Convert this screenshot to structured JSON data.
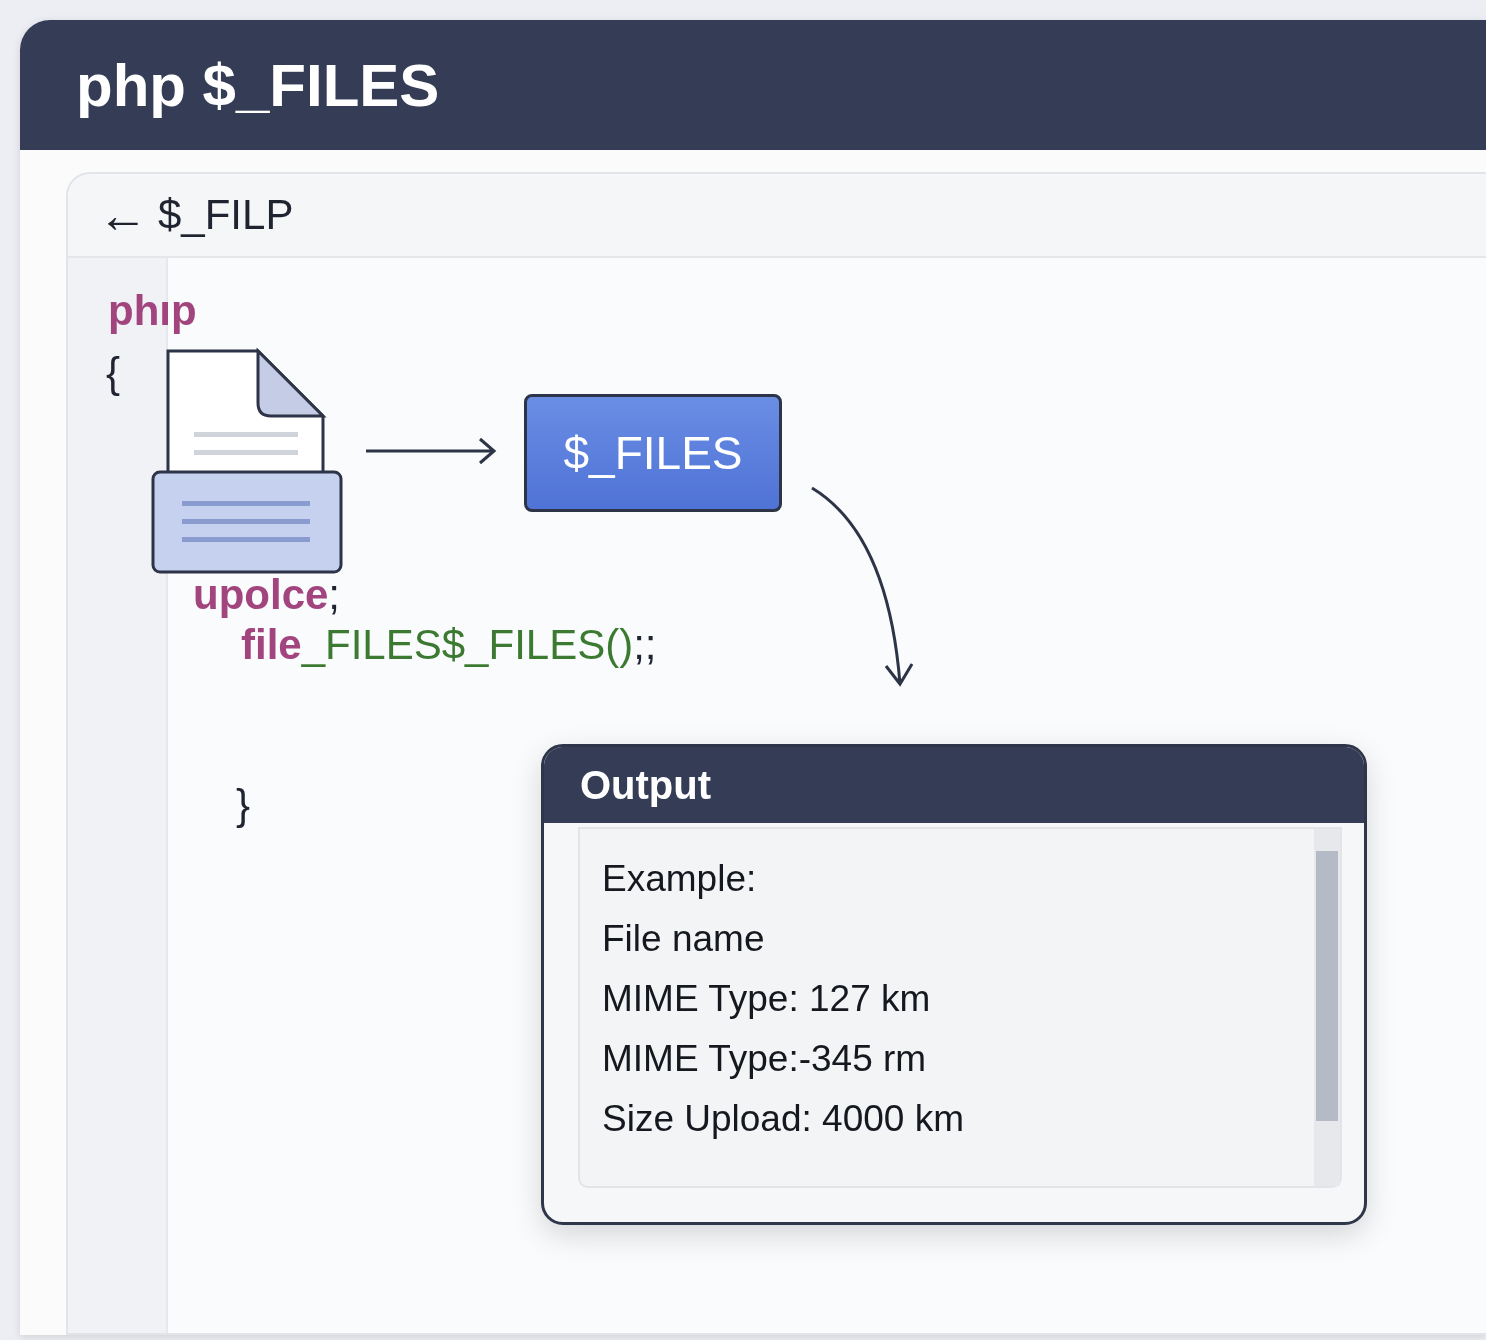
{
  "window": {
    "title": "php $_FILES"
  },
  "toolbar": {
    "back_icon": "←",
    "label": "$_FILP"
  },
  "code_lines": [
    {
      "segments": [
        {
          "text": "phıp",
          "kind": "keyword"
        }
      ]
    },
    {
      "segments": [
        {
          "text": "{",
          "kind": "plain"
        }
      ]
    },
    {
      "segments": [
        {
          "text": "upolce",
          "kind": "keyword"
        },
        {
          "text": ";",
          "kind": "plain"
        }
      ]
    },
    {
      "segments": [
        {
          "text": "file",
          "kind": "keyword"
        },
        {
          "text": "_FILES$_FILES()",
          "kind": "string"
        },
        {
          "text": ";;",
          "kind": "plain"
        }
      ]
    },
    {
      "segments": [
        {
          "text": "}",
          "kind": "plain"
        }
      ]
    }
  ],
  "diagram": {
    "node": "$_FILES"
  },
  "output": {
    "title": "Output",
    "lines": [
      "Example:",
      "File name",
      "MIME Type: 127 km",
      "MIME Type:-345 rm",
      "Size Upload: 4000 km"
    ]
  }
}
